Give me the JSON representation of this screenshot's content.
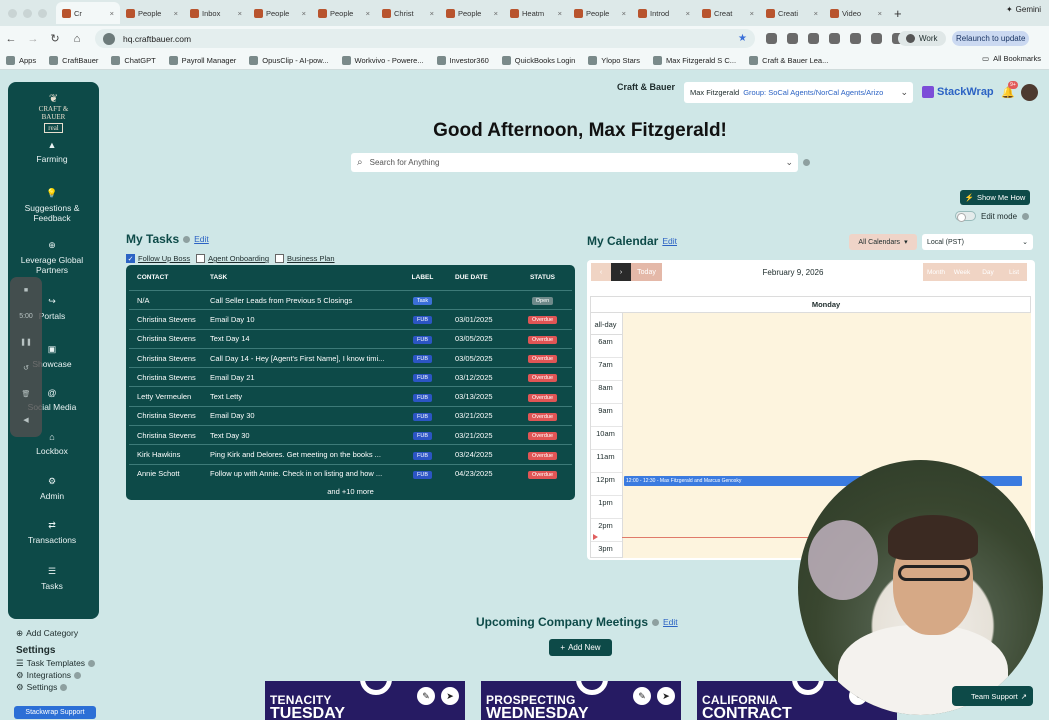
{
  "browser": {
    "tabs": [
      "Cr",
      "People",
      "Inbox",
      "People",
      "People",
      "Christ",
      "People",
      "Heatm",
      "People",
      "Introd",
      "Creat",
      "Creati",
      "Video"
    ],
    "gemini": "Gemini",
    "url": "hq.craftbauer.com",
    "work": "Work",
    "relaunch": "Relaunch to update",
    "bookmarks": [
      "Apps",
      "CraftBauer",
      "ChatGPT",
      "Payroll Manager",
      "OpusClip - AI-pow...",
      "Workvivo - Powere...",
      "Investor360",
      "QuickBooks Login",
      "Ylopo Stars",
      "Max Fitzgerald S C...",
      "Craft & Bauer Lea..."
    ],
    "all_bookmarks": "All Bookmarks"
  },
  "logo": {
    "line1": "CRAFT & BAUER",
    "line2": "real"
  },
  "sidebar": {
    "items": [
      {
        "label": "Farming",
        "icon": "chevron-up-icon"
      },
      {
        "label": "Suggestions & Feedback",
        "icon": "lightbulb-icon"
      },
      {
        "label": "Leverage Global Partners",
        "icon": "globe-icon"
      },
      {
        "label": "Portals",
        "icon": "portal-icon"
      },
      {
        "label": "Showcase",
        "icon": "image-icon"
      },
      {
        "label": "Social Media",
        "icon": "at-icon"
      },
      {
        "label": "Lockbox",
        "icon": "home-icon"
      },
      {
        "label": "Admin",
        "icon": "admin-icon"
      },
      {
        "label": "Transactions",
        "icon": "handshake-icon"
      },
      {
        "label": "Tasks",
        "icon": "list-icon"
      }
    ],
    "add_category": "Add Category",
    "settings_title": "Settings",
    "settings_items": [
      "Task Templates",
      "Integrations",
      "Settings"
    ],
    "support": "Stackwrap Support"
  },
  "recorder": {
    "time": "5:00"
  },
  "header": {
    "brand": "Craft & Bauer",
    "user": "Max Fitzgerald",
    "group": "Group: SoCal Agents/NorCal Agents/Arizo",
    "app": "StackWrap",
    "notif_count": "9+"
  },
  "greeting": "Good Afternoon, Max Fitzgerald!",
  "search_placeholder": "Search for Anything",
  "show_me_how": "Show Me How",
  "edit_mode": "Edit mode",
  "tasks": {
    "title": "My Tasks",
    "edit": "Edit",
    "filters": [
      "Follow Up Boss",
      "Agent Onboarding",
      "Business Plan"
    ],
    "columns": [
      "CONTACT",
      "TASK",
      "LABEL",
      "DUE DATE",
      "STATUS"
    ],
    "rows": [
      {
        "contact": "N/A",
        "task": "Call Seller Leads from Previous 5 Closings",
        "label": "Task",
        "due": "",
        "status": "Open"
      },
      {
        "contact": "Christina Stevens",
        "task": "Email Day 10",
        "label": "FUB",
        "due": "03/01/2025",
        "status": "Overdue"
      },
      {
        "contact": "Christina Stevens",
        "task": "Text Day 14",
        "label": "FUB",
        "due": "03/05/2025",
        "status": "Overdue"
      },
      {
        "contact": "Christina Stevens",
        "task": "Call Day 14 - Hey [Agent's First Name], I know timi...",
        "label": "FUB",
        "due": "03/05/2025",
        "status": "Overdue"
      },
      {
        "contact": "Christina Stevens",
        "task": "Email Day 21",
        "label": "FUB",
        "due": "03/12/2025",
        "status": "Overdue"
      },
      {
        "contact": "Letty Vermeulen",
        "task": "Text Letty",
        "label": "FUB",
        "due": "03/13/2025",
        "status": "Overdue"
      },
      {
        "contact": "Christina Stevens",
        "task": "Email Day 30",
        "label": "FUB",
        "due": "03/21/2025",
        "status": "Overdue"
      },
      {
        "contact": "Christina Stevens",
        "task": "Text Day 30",
        "label": "FUB",
        "due": "03/21/2025",
        "status": "Overdue"
      },
      {
        "contact": "Kirk Hawkins",
        "task": "Ping Kirk and Delores. Get meeting on the books ...",
        "label": "FUB",
        "due": "03/24/2025",
        "status": "Overdue"
      },
      {
        "contact": "Annie Schott",
        "task": "Follow up with Annie. Check in on listing and how ...",
        "label": "FUB",
        "due": "04/23/2025",
        "status": "Overdue"
      }
    ],
    "more": "and +10 more"
  },
  "calendar": {
    "title": "My Calendar",
    "edit": "Edit",
    "all_calendars": "All Calendars",
    "timezone": "Local (PST)",
    "today": "Today",
    "date": "February 9, 2026",
    "views": [
      "Month",
      "Week",
      "Day",
      "List"
    ],
    "day": "Monday",
    "allday": "all-day",
    "hours": [
      "6am",
      "7am",
      "8am",
      "9am",
      "10am",
      "11am",
      "12pm",
      "1pm",
      "2pm",
      "3pm"
    ],
    "event": "12:00 - 12:30 - Max Fitzgerald and Marcus Genosky"
  },
  "meetings": {
    "title": "Upcoming Company Meetings",
    "edit": "Edit",
    "add_new": "Add New",
    "cards": [
      {
        "line1": "TENACITY",
        "line2": "TUESDAY"
      },
      {
        "line1": "PROSPECTING",
        "line2": "WEDNESDAY"
      },
      {
        "line1": "CALIFORNIA",
        "line2": "CONTRACT"
      }
    ]
  },
  "team_support": "Team Support",
  "colors": {
    "primary": "#0d4a48",
    "accent": "#2c63c4",
    "overdue": "#e05555",
    "background": "#cfe7e7"
  }
}
